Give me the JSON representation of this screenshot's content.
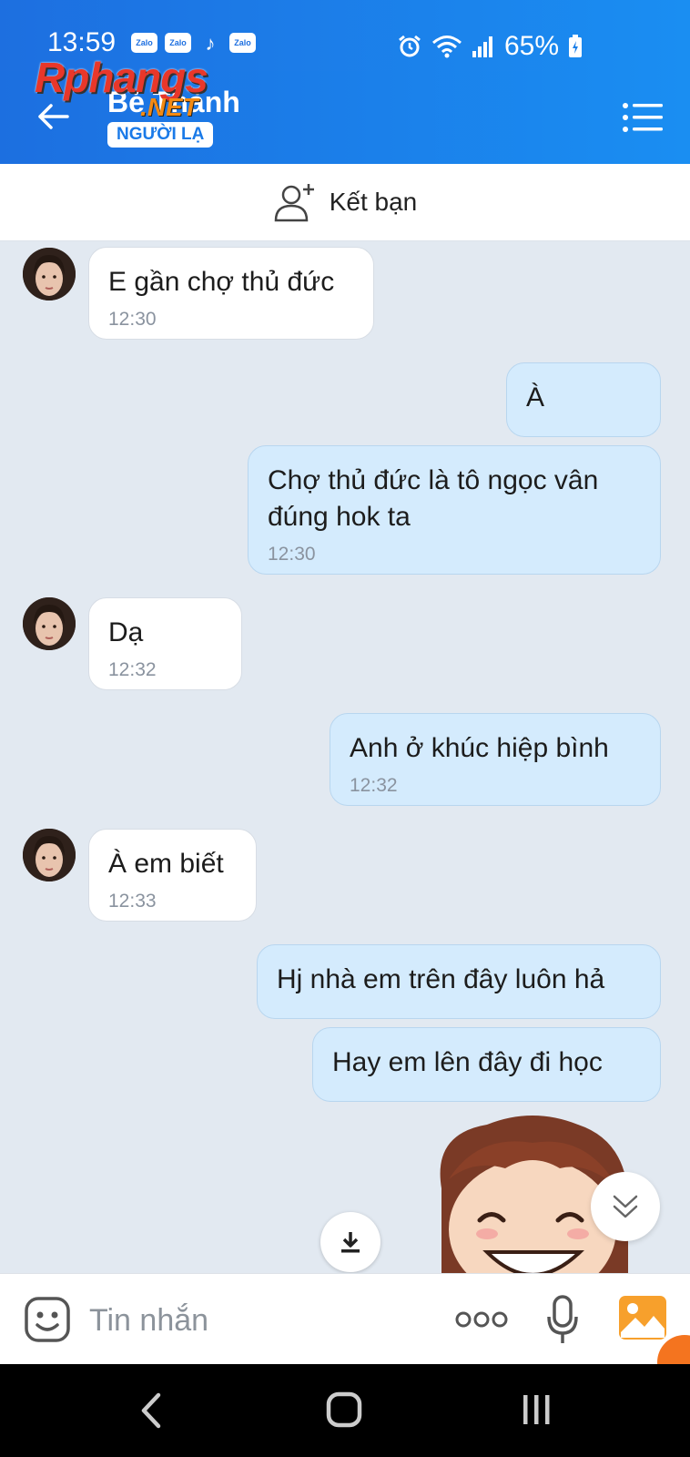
{
  "status_bar": {
    "time": "13:59",
    "notif_labels": [
      "Zalo",
      "Zalo",
      "Zalo"
    ],
    "battery": "65%"
  },
  "header": {
    "contact_name": "Bé Thành",
    "badge": "NGƯỜI LẠ"
  },
  "watermark": {
    "main": "Rphangs",
    "sub": ".NET"
  },
  "add_friend": {
    "label": "Kết bạn"
  },
  "messages": [
    {
      "side": "in",
      "text": "E gần chợ thủ đức",
      "time": "12:30"
    },
    {
      "side": "out",
      "text": "À",
      "time": ""
    },
    {
      "side": "out",
      "text": "Chợ thủ đức là tô ngọc vân đúng hok ta",
      "time": "12:30"
    },
    {
      "side": "in",
      "text": "Dạ",
      "time": "12:32"
    },
    {
      "side": "out",
      "text": "Anh ở khúc hiệp bình",
      "time": "12:32"
    },
    {
      "side": "in",
      "text": "À em biết",
      "time": "12:33"
    },
    {
      "side": "out",
      "text": "Hj nhà em trên đây luôn hả",
      "time": ""
    },
    {
      "side": "out",
      "text": "Hay em lên đây đi học",
      "time": ""
    }
  ],
  "composer": {
    "placeholder": "Tin nhắn"
  },
  "colors": {
    "header_blue": "#1a8ef2",
    "outgoing_bubble": "#d4ebfd",
    "incoming_bubble": "#ffffff",
    "chat_background": "#e2e9f1",
    "image_button": "#f7a02c"
  },
  "icons": [
    "back-arrow-icon",
    "menu-list-icon",
    "add-friend-icon",
    "emoji-icon",
    "more-dots-icon",
    "microphone-icon",
    "image-icon",
    "download-icon",
    "chevron-double-down-icon"
  ]
}
